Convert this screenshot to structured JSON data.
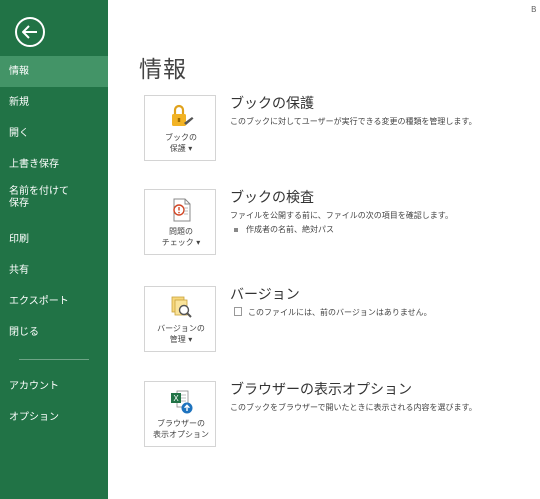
{
  "sidebar": {
    "items": [
      {
        "label": "情報"
      },
      {
        "label": "新規"
      },
      {
        "label": "開く"
      },
      {
        "label": "上書き保存"
      },
      {
        "label": "名前を付けて保存"
      },
      {
        "label": "印刷"
      },
      {
        "label": "共有"
      },
      {
        "label": "エクスポート"
      },
      {
        "label": "閉じる"
      },
      {
        "label": "アカウント"
      },
      {
        "label": "オプション"
      }
    ],
    "name_save_line1": "名前を付けて",
    "name_save_line2": "保存"
  },
  "corner_text": "B",
  "main": {
    "title": "情報",
    "sections": [
      {
        "heading": "ブックの保護",
        "description": "このブックに対してユーザーが実行できる変更の種類を管理します。",
        "button_line1": "ブックの",
        "button_line2": "保護 ▾",
        "icon": "lock-icon"
      },
      {
        "heading": "ブックの検査",
        "description": "ファイルを公開する前に、ファイルの次の項目を確認します。",
        "bullet": "作成者の名前、絶対パス",
        "button_line1": "問題の",
        "button_line2": "チェック ▾",
        "icon": "inspect-document-icon"
      },
      {
        "heading": "バージョン",
        "description": "このファイルには、前のバージョンはありません。",
        "button_line1": "バージョンの",
        "button_line2": "管理 ▾",
        "icon": "versions-icon"
      },
      {
        "heading": "ブラウザーの表示オプション",
        "description": "このブックをブラウザーで開いたときに表示される内容を選びます。",
        "button_line1": "ブラウザーの",
        "button_line2": "表示オプション",
        "icon": "browser-view-icon"
      }
    ]
  },
  "colors": {
    "sidebar_bg": "#217346",
    "sidebar_active": "#439467"
  }
}
